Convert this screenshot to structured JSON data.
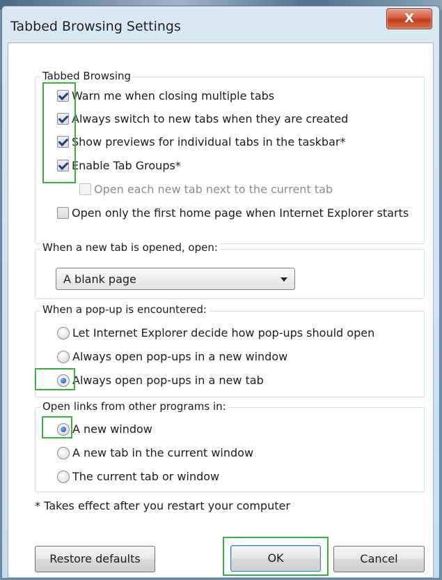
{
  "dialog": {
    "title": "Tabbed Browsing Settings",
    "close_label": "X"
  },
  "groups": {
    "tabbed_browsing": {
      "label": "Tabbed Browsing",
      "options": [
        {
          "label": "Warn me when closing multiple tabs",
          "checked": true,
          "enabled": true
        },
        {
          "label": "Always switch to new tabs when they are created",
          "checked": true,
          "enabled": true
        },
        {
          "label": "Show previews for individual tabs in the taskbar*",
          "checked": true,
          "enabled": true
        },
        {
          "label": "Enable Tab Groups*",
          "checked": true,
          "enabled": true
        },
        {
          "label": "Open each new tab next to the current tab",
          "checked": false,
          "enabled": false
        },
        {
          "label": "Open only the first home page when Internet Explorer starts",
          "checked": false,
          "enabled": true
        }
      ]
    },
    "new_tab": {
      "label": "When a new tab is opened, open:",
      "selected": "A blank page"
    },
    "popup": {
      "label": "When a pop-up is encountered:",
      "options": [
        {
          "label": "Let Internet Explorer decide how pop-ups should open",
          "selected": false
        },
        {
          "label": "Always open pop-ups in a new window",
          "selected": false
        },
        {
          "label": "Always open pop-ups in a new tab",
          "selected": true
        }
      ]
    },
    "open_links": {
      "label": "Open links from other programs in:",
      "options": [
        {
          "label": "A new window",
          "selected": true
        },
        {
          "label": "A new tab in the current window",
          "selected": false
        },
        {
          "label": "The current tab or window",
          "selected": false
        }
      ]
    }
  },
  "footnote": "* Takes effect after you restart your computer",
  "buttons": {
    "restore": "Restore defaults",
    "ok": "OK",
    "cancel": "Cancel"
  },
  "colors": {
    "highlight": "#3cb043",
    "title_bg": "#cfe0f0",
    "close_button": "#c2391c"
  }
}
